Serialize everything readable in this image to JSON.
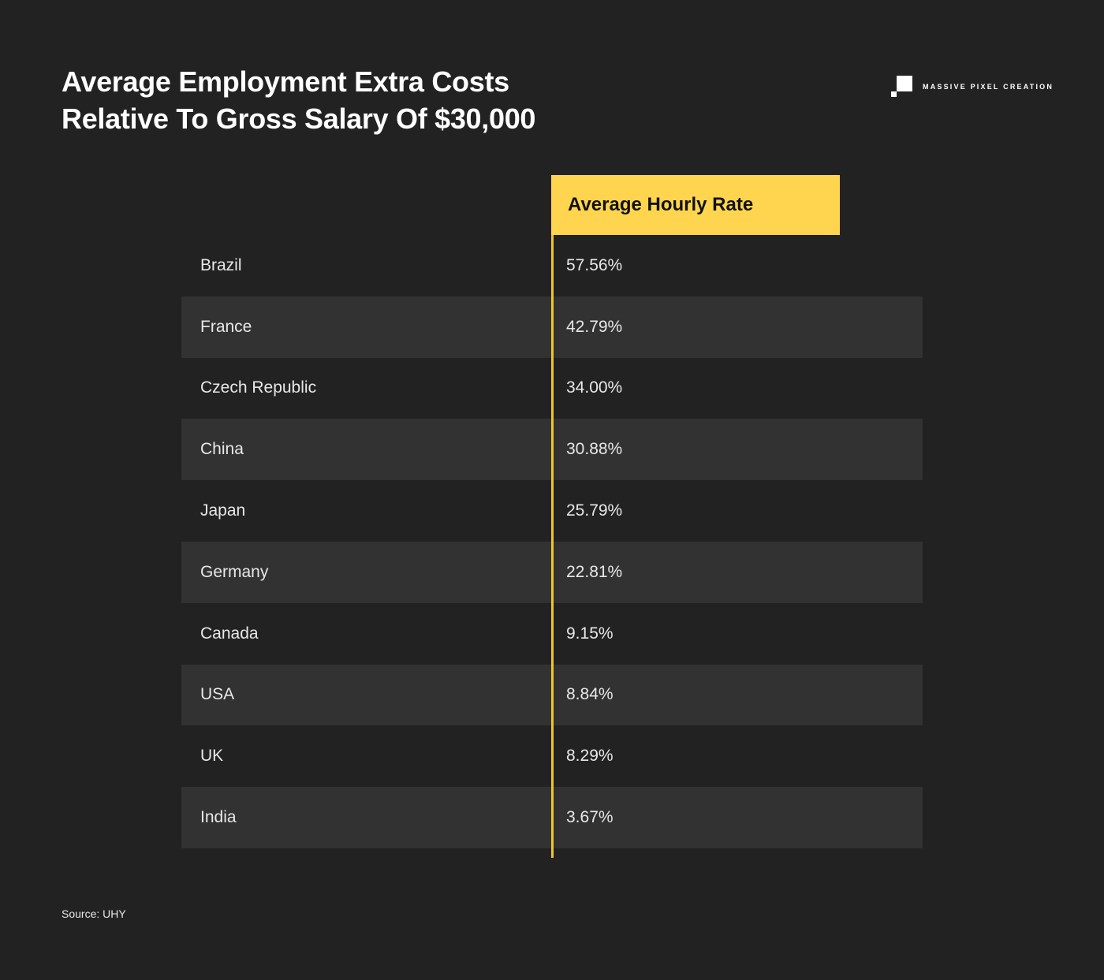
{
  "title_line1": "Average Employment Extra Costs",
  "title_line2": "Relative To Gross Salary Of $30,000",
  "brand": "MASSIVE PIXEL CREATION",
  "source": "Source: UHY",
  "colors": {
    "background": "#222222",
    "alt_row": "#323232",
    "accent": "#ffd54f"
  },
  "chart_data": {
    "type": "table",
    "title": "Average Employment Extra Costs Relative To Gross Salary Of $30,000",
    "column_header": "Average Hourly Rate",
    "categories": [
      "Brazil",
      "France",
      "Czech Republic",
      "China",
      "Japan",
      "Germany",
      "Canada",
      "USA",
      "UK",
      "India"
    ],
    "values": [
      57.56,
      42.79,
      34.0,
      30.88,
      25.79,
      22.81,
      9.15,
      8.84,
      8.29,
      3.67
    ],
    "value_labels": [
      "57.56%",
      "42.79%",
      "34.00%",
      "30.88%",
      "25.79%",
      "22.81%",
      "9.15%",
      "8.84%",
      "8.29%",
      "3.67%"
    ],
    "source": "UHY"
  }
}
